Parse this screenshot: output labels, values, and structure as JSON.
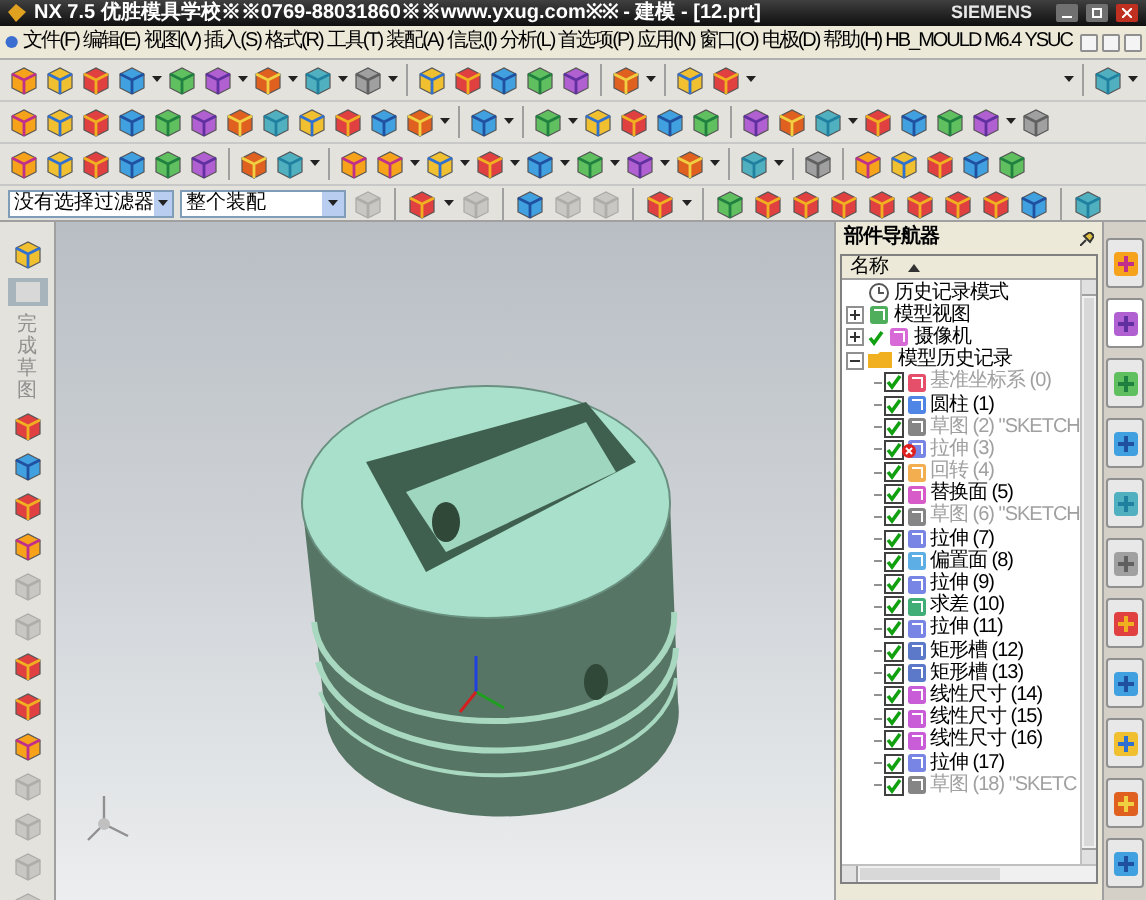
{
  "window": {
    "title": "NX 7.5 优胜模具学校※※0769-88031860※※www.yxug.com※※ - 建模 - [12.prt]",
    "brand": "SIEMENS"
  },
  "menu": [
    "文件(F)",
    "编辑(E)",
    "视图(V)",
    "插入(S)",
    "格式(R)",
    "工具(T)",
    "装配(A)",
    "信息(I)",
    "分析(L)",
    "首选项(P)",
    "应用(N)",
    "窗口(O)",
    "电极(D)",
    "帮助(H)",
    "HB_MOULD M6.4",
    "YSUC"
  ],
  "filter": {
    "type_filter": "没有选择过滤器",
    "scope": "整个装配"
  },
  "resource_tabs": [
    {
      "selected": false
    },
    {
      "selected": true
    },
    {
      "selected": false
    },
    {
      "selected": false
    },
    {
      "selected": false
    },
    {
      "selected": false
    },
    {
      "selected": false
    },
    {
      "selected": false
    },
    {
      "selected": false
    },
    {
      "selected": false
    },
    {
      "selected": false
    }
  ],
  "left_toolbar": {
    "finish_sketch": "完成草图"
  },
  "navigator": {
    "title": "部件导航器",
    "column": "名称",
    "tree": [
      {
        "label": "历史记录模式",
        "kind": "mode"
      },
      {
        "label": "模型视图",
        "kind": "views",
        "expanded": false
      },
      {
        "label": "摄像机",
        "kind": "cameras",
        "expanded": false,
        "checked": true
      },
      {
        "label": "模型历史记录",
        "kind": "folder",
        "expanded": true,
        "children": [
          {
            "label": "基准坐标系 (0)",
            "kind": "datum",
            "checked": true,
            "dimmed": true,
            "error": false
          },
          {
            "label": "圆柱 (1)",
            "kind": "cylinder",
            "checked": true,
            "dimmed": false,
            "error": false
          },
          {
            "label": "草图 (2) \"SKETCH",
            "kind": "sketch",
            "checked": true,
            "dimmed": true,
            "error": false
          },
          {
            "label": "拉伸 (3)",
            "kind": "extrude",
            "checked": true,
            "dimmed": true,
            "error": true
          },
          {
            "label": "回转 (4)",
            "kind": "revolve",
            "checked": true,
            "dimmed": true,
            "error": false
          },
          {
            "label": "替换面 (5)",
            "kind": "replace",
            "checked": true,
            "dimmed": false,
            "error": false
          },
          {
            "label": "草图 (6) \"SKETCH",
            "kind": "sketch",
            "checked": true,
            "dimmed": true,
            "error": false
          },
          {
            "label": "拉伸 (7)",
            "kind": "extrude",
            "checked": true,
            "dimmed": false,
            "error": false
          },
          {
            "label": "偏置面 (8)",
            "kind": "offset",
            "checked": true,
            "dimmed": false,
            "error": false
          },
          {
            "label": "拉伸 (9)",
            "kind": "extrude",
            "checked": true,
            "dimmed": false,
            "error": false
          },
          {
            "label": "求差 (10)",
            "kind": "subtract",
            "checked": true,
            "dimmed": false,
            "error": false
          },
          {
            "label": "拉伸 (11)",
            "kind": "extrude",
            "checked": true,
            "dimmed": false,
            "error": false
          },
          {
            "label": "矩形槽 (12)",
            "kind": "pocket",
            "checked": true,
            "dimmed": false,
            "error": false
          },
          {
            "label": "矩形槽 (13)",
            "kind": "pocket",
            "checked": true,
            "dimmed": false,
            "error": false
          },
          {
            "label": "线性尺寸 (14)",
            "kind": "dimension",
            "checked": true,
            "dimmed": false,
            "error": false
          },
          {
            "label": "线性尺寸 (15)",
            "kind": "dimension",
            "checked": true,
            "dimmed": false,
            "error": false
          },
          {
            "label": "线性尺寸 (16)",
            "kind": "dimension",
            "checked": true,
            "dimmed": false,
            "error": false
          },
          {
            "label": "拉伸 (17)",
            "kind": "extrude",
            "checked": true,
            "dimmed": false,
            "error": false
          },
          {
            "label": "草图 (18) \"SKETC",
            "kind": "sketch",
            "checked": true,
            "dimmed": true,
            "error": false
          }
        ]
      }
    ]
  }
}
